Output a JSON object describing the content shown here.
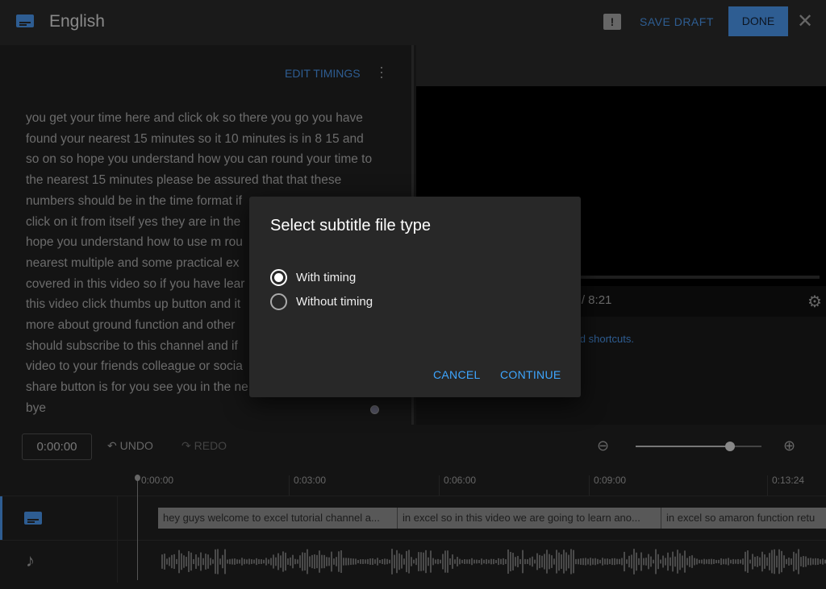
{
  "header": {
    "title": "English",
    "save_draft": "SAVE DRAFT",
    "done": "DONE",
    "close": "✕",
    "feedback": "!"
  },
  "editor": {
    "edit_timings": "EDIT TIMINGS",
    "lines": [
      "you get your time here and click ok so there you go you have",
      "found your nearest 15 minutes so it 10 minutes is in 8 15 and",
      "so on so hope you understand how you can round your time to",
      "the nearest 15 minutes please be assured that that these",
      "numbers should be in the time format if",
      "click on it from itself yes they are in the",
      "hope you understand how to use m rou",
      "nearest multiple and some practical ex",
      "covered in this video so if you have lear",
      "this video click thumbs up button and it",
      "more about ground function and other",
      "should subscribe to this channel and if",
      "video to your friends colleague or socia",
      "share button is for you see you in the ne",
      "bye"
    ]
  },
  "player": {
    "time": "00 / 8:21",
    "shortcuts": "oard shortcuts."
  },
  "toolbar": {
    "timecode": "0:00:00",
    "undo": "UNDO",
    "redo": "REDO",
    "zoom_level": 0.75
  },
  "timeline": {
    "ticks": [
      "0:00:00",
      "0:03:00",
      "0:06:00",
      "0:09:00",
      "0:13:24"
    ],
    "segments": [
      "hey guys welcome to excel tutorial channel a...",
      "in excel so in this video we are going to learn  ano...",
      "in excel so amaron function retu"
    ]
  },
  "dialog": {
    "title": "Select subtitle file type",
    "options": [
      {
        "label": "With timing",
        "selected": true
      },
      {
        "label": "Without timing",
        "selected": false
      }
    ],
    "cancel": "CANCEL",
    "continue": "CONTINUE"
  },
  "colors": {
    "accent": "#3ea6ff",
    "dim_accent": "#2e5d92"
  }
}
